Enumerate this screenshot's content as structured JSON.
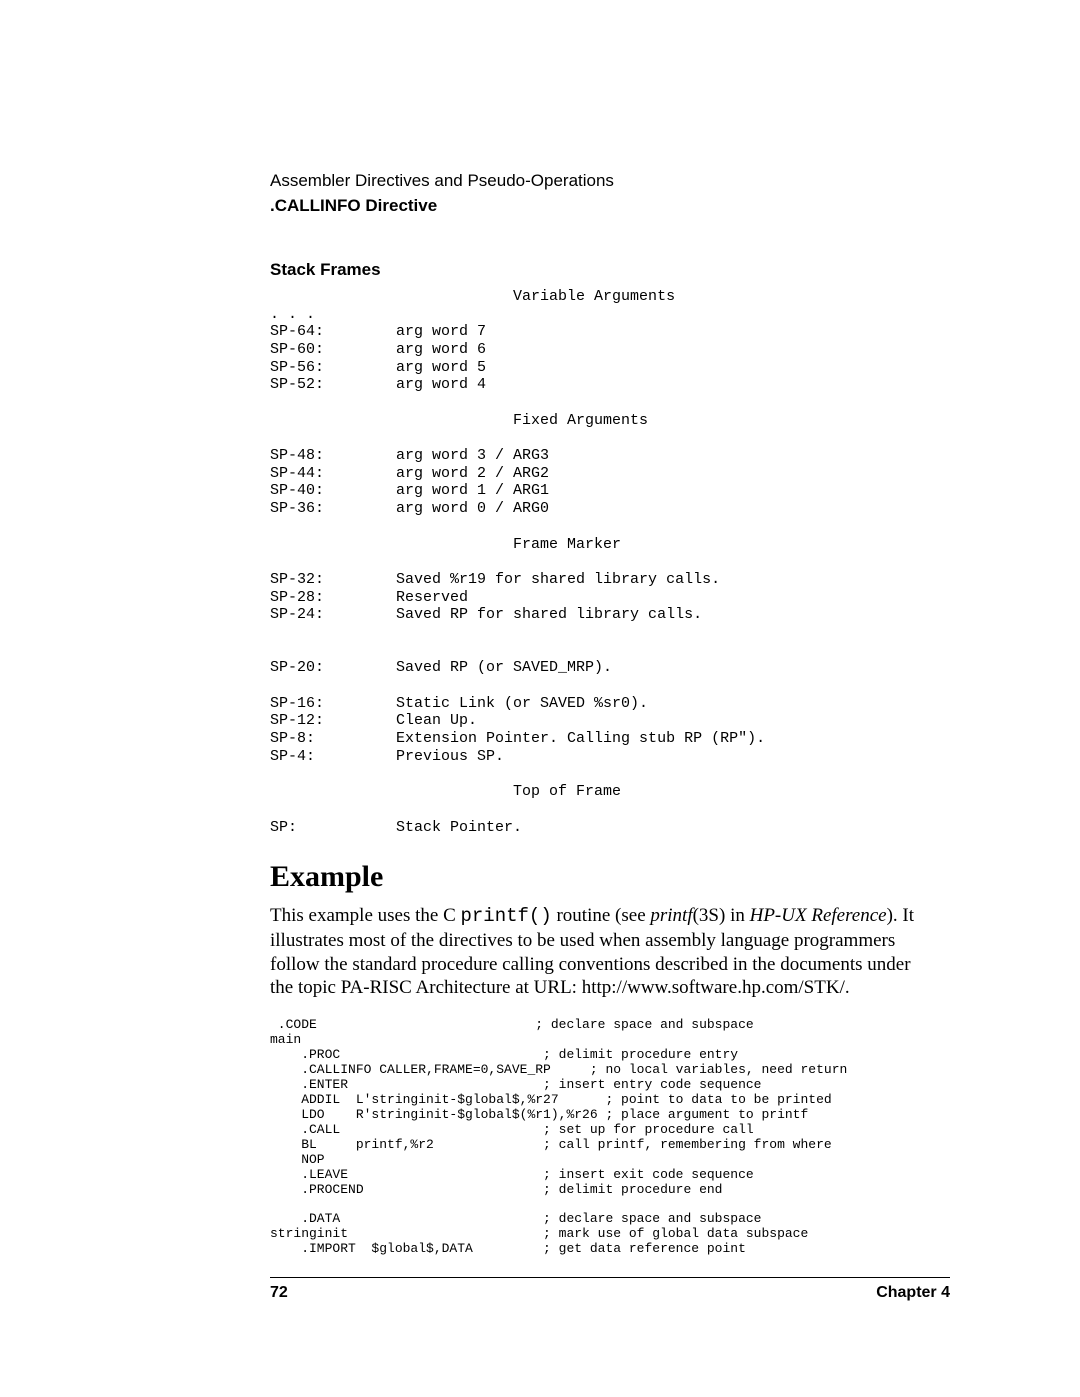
{
  "header": {
    "line1": "Assembler Directives and Pseudo-Operations",
    "line2": ".CALLINFO Directive"
  },
  "stackFramesHeading": "Stack Frames",
  "stackFramesText": "                           Variable Arguments\n. . .\nSP-64:        arg word 7\nSP-60:        arg word 6\nSP-56:        arg word 5\nSP-52:        arg word 4\n\n                           Fixed Arguments\n\nSP-48:        arg word 3 / ARG3\nSP-44:        arg word 2 / ARG2\nSP-40:        arg word 1 / ARG1\nSP-36:        arg word 0 / ARG0\n\n                           Frame Marker\n\nSP-32:        Saved %r19 for shared library calls.\nSP-28:        Reserved\nSP-24:        Saved RP for shared library calls.\n\n\nSP-20:        Saved RP (or SAVED_MRP).\n\nSP-16:        Static Link (or SAVED %sr0).\nSP-12:        Clean Up.\nSP-8:         Extension Pointer. Calling stub RP (RP\").\nSP-4:         Previous SP.\n\n                           Top of Frame\n\nSP:           Stack Pointer.",
  "exampleHeading": "Example",
  "paragraph": {
    "t1": "This example uses the C ",
    "mono1": "printf()",
    "t2": " routine (see ",
    "ital1": "printf",
    "t3": "(3S) in ",
    "ital2": "HP-UX Reference",
    "t4": "). It illustrates most of the directives to be used when assembly language programmers follow the standard procedure calling conventions described in the documents under the topic PA-RISC Architecture at URL:  http://www.software.hp.com/STK/."
  },
  "codeBlock": " .CODE                            ; declare space and subspace\nmain\n    .PROC                          ; delimit procedure entry\n    .CALLINFO CALLER,FRAME=0,SAVE_RP     ; no local variables, need return\n    .ENTER                         ; insert entry code sequence\n    ADDIL  L'stringinit-$global$,%r27      ; point to data to be printed\n    LDO    R'stringinit-$global$(%r1),%r26 ; place argument to printf\n    .CALL                          ; set up for procedure call\n    BL     printf,%r2              ; call printf, remembering from where\n    NOP\n    .LEAVE                         ; insert exit code sequence\n    .PROCEND                       ; delimit procedure end\n\n    .DATA                          ; declare space and subspace\nstringinit                         ; mark use of global data subspace\n    .IMPORT  $global$,DATA         ; get data reference point",
  "footer": {
    "pageNumber": "72",
    "chapter": "Chapter 4"
  }
}
